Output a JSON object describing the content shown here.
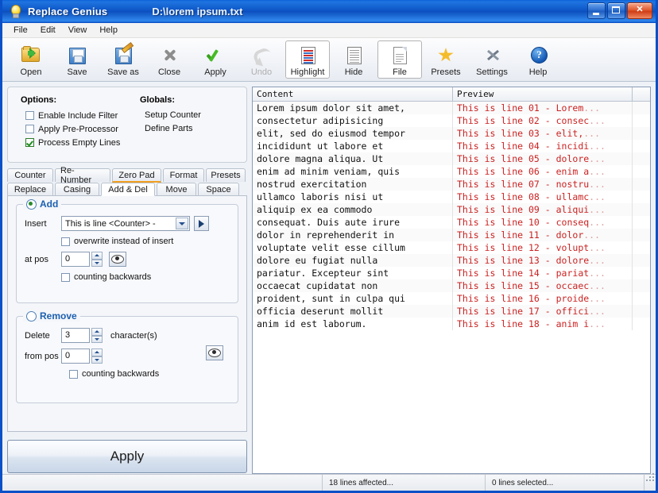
{
  "window": {
    "app_title": "Replace Genius",
    "file_path": "D:\\lorem ipsum.txt",
    "icon": "lightbulb-icon",
    "minimize_label": "Minimize",
    "maximize_label": "Maximize",
    "close_label": "Close"
  },
  "menu": {
    "items": [
      {
        "label": "File"
      },
      {
        "label": "Edit"
      },
      {
        "label": "View"
      },
      {
        "label": "Help"
      }
    ]
  },
  "toolbar": {
    "buttons": [
      {
        "label": "Open",
        "icon": "open-folder-icon",
        "state": "normal"
      },
      {
        "label": "Save",
        "icon": "floppy-disk-icon",
        "state": "normal"
      },
      {
        "label": "Save as",
        "icon": "floppy-pencil-icon",
        "state": "normal"
      },
      {
        "label": "Close",
        "icon": "x-close-icon",
        "state": "normal"
      },
      {
        "label": "Apply",
        "icon": "green-check-icon",
        "state": "normal"
      },
      {
        "label": "Undo",
        "icon": "undo-arrow-icon",
        "state": "disabled"
      },
      {
        "label": "Highlight",
        "icon": "highlight-lines-icon",
        "state": "selected"
      },
      {
        "label": "Hide",
        "icon": "hide-lines-icon",
        "state": "normal"
      },
      {
        "label": "File",
        "icon": "document-icon",
        "state": "selected"
      },
      {
        "label": "Presets",
        "icon": "star-icon",
        "state": "normal"
      },
      {
        "label": "Settings",
        "icon": "tools-icon",
        "state": "normal"
      },
      {
        "label": "Help",
        "icon": "question-mark-icon",
        "state": "normal"
      }
    ]
  },
  "options": {
    "options_heading": "Options:",
    "globals_heading": "Globals:",
    "checkboxes": [
      {
        "label": "Enable Include Filter",
        "checked": false
      },
      {
        "label": "Apply Pre-Processor",
        "checked": false
      },
      {
        "label": "Process Empty Lines",
        "checked": true
      }
    ],
    "globals": [
      {
        "label": "Setup Counter"
      },
      {
        "label": "Define Parts"
      }
    ]
  },
  "tabs": {
    "row1": [
      {
        "label": "Counter",
        "state": "normal"
      },
      {
        "label": "Re-Number",
        "state": "normal"
      },
      {
        "label": "Zero Pad",
        "state": "hot"
      },
      {
        "label": "Format",
        "state": "normal"
      },
      {
        "label": "Presets",
        "state": "normal"
      }
    ],
    "row2": [
      {
        "label": "Replace",
        "state": "normal"
      },
      {
        "label": "Casing",
        "state": "normal"
      },
      {
        "label": "Add & Del",
        "state": "active"
      },
      {
        "label": "Move",
        "state": "normal"
      },
      {
        "label": "Space",
        "state": "normal"
      }
    ]
  },
  "add_group": {
    "legend": "Add",
    "selected": true,
    "insert_label": "Insert",
    "insert_value": "This is line <Counter> -",
    "overwrite_label": "overwrite instead of insert",
    "overwrite_checked": false,
    "at_pos_label": "at pos",
    "at_pos_value": "0",
    "counting_backwards_label": "counting backwards",
    "counting_backwards_checked": false,
    "preview_icon": "eye-icon",
    "go_icon": "play-arrow-icon",
    "dropdown_icon": "chevron-down-icon"
  },
  "remove_group": {
    "legend": "Remove",
    "selected": false,
    "delete_label": "Delete",
    "delete_value": "3",
    "characters_label": "character(s)",
    "from_pos_label": "from pos",
    "from_pos_value": "0",
    "counting_backwards_label": "counting backwards",
    "counting_backwards_checked": false,
    "preview_icon": "eye-icon"
  },
  "apply_button": {
    "label": "Apply"
  },
  "list": {
    "headers": [
      "Content",
      "Preview",
      ""
    ],
    "rows": [
      {
        "content": "Lorem ipsum dolor sit amet,",
        "preview": "This is line 01 - Lorem",
        "ellipsis": "..."
      },
      {
        "content": "consectetur adipisicing",
        "preview": "This is line 02 - consec",
        "ellipsis": "..."
      },
      {
        "content": "elit, sed do eiusmod tempor",
        "preview": "This is line 03 - elit,",
        "ellipsis": "..."
      },
      {
        "content": "incididunt ut labore et",
        "preview": "This is line 04 - incidi",
        "ellipsis": "..."
      },
      {
        "content": "dolore magna aliqua. Ut",
        "preview": "This is line 05 - dolore",
        "ellipsis": "..."
      },
      {
        "content": "enim ad minim veniam, quis",
        "preview": "This is line 06 - enim a",
        "ellipsis": "..."
      },
      {
        "content": "nostrud exercitation",
        "preview": "This is line 07 - nostru",
        "ellipsis": "..."
      },
      {
        "content": "ullamco laboris nisi ut",
        "preview": "This is line 08 - ullamc",
        "ellipsis": "..."
      },
      {
        "content": "aliquip ex ea commodo",
        "preview": "This is line 09 - aliqui",
        "ellipsis": "..."
      },
      {
        "content": "consequat. Duis aute irure",
        "preview": "This is line 10 - conseq",
        "ellipsis": "..."
      },
      {
        "content": "dolor in reprehenderit in",
        "preview": "This is line 11 - dolor",
        "ellipsis": "..."
      },
      {
        "content": "voluptate velit esse cillum",
        "preview": "This is line 12 - volupt",
        "ellipsis": "..."
      },
      {
        "content": "dolore eu fugiat nulla",
        "preview": "This is line 13 - dolore",
        "ellipsis": "..."
      },
      {
        "content": "pariatur. Excepteur sint",
        "preview": "This is line 14 - pariat",
        "ellipsis": "..."
      },
      {
        "content": "occaecat cupidatat non",
        "preview": "This is line 15 - occaec",
        "ellipsis": "..."
      },
      {
        "content": "proident, sunt in culpa qui",
        "preview": "This is line 16 - proide",
        "ellipsis": "..."
      },
      {
        "content": "officia deserunt mollit",
        "preview": "This is line 17 - offici",
        "ellipsis": "..."
      },
      {
        "content": "anim id est laborum.",
        "preview": "This is line 18 - anim i",
        "ellipsis": "..."
      }
    ]
  },
  "statusbar": {
    "segment1": "",
    "segment2": "18 lines affected...",
    "segment3": "0 lines selected..."
  },
  "colors": {
    "titlebar_blue": "#0d55c6",
    "window_border": "#0a50c8",
    "preview_text_red": "#cc2222",
    "legend_blue": "#1c5fb0",
    "active_tab_underline": "#f0a020"
  }
}
